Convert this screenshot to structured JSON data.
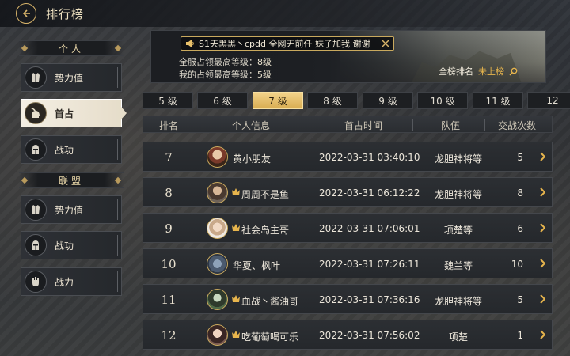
{
  "header": {
    "title": "排行榜"
  },
  "sidebar": {
    "personal_header": "个人",
    "personal_items": [
      {
        "label": "势力值",
        "icon": "armor-icon",
        "active": false
      },
      {
        "label": "首占",
        "icon": "helmet-plume-icon",
        "active": true
      },
      {
        "label": "战功",
        "icon": "knight-helmet-icon",
        "active": false
      }
    ],
    "alliance_header": "联盟",
    "alliance_items": [
      {
        "label": "势力值",
        "icon": "armor-icon",
        "active": false
      },
      {
        "label": "战功",
        "icon": "knight-helmet-icon",
        "active": false
      },
      {
        "label": "战力",
        "icon": "fist-icon",
        "active": false
      }
    ]
  },
  "banner": {
    "announcement": "S1天黑黑丶cpdd 全网无前任 妹子加我 谢谢",
    "server_max_label": "全服占领最高等级：",
    "server_max_value": "8级",
    "my_max_label": "我的占领最高等级：",
    "my_max_value": "5级",
    "my_rank_label": "全榜排名",
    "my_rank_value": "未上榜"
  },
  "level_tabs": [
    "5 级",
    "6 级",
    "7 级",
    "8 级",
    "9 级",
    "10 级",
    "11 级",
    "12"
  ],
  "active_tab": "7 级",
  "table": {
    "columns": [
      "排名",
      "个人信息",
      "首占时间",
      "队伍",
      "交战次数"
    ],
    "rows": [
      {
        "rank": "7",
        "name": "黄小朋友",
        "crown": false,
        "time": "2022-03-31 03:40:10",
        "team": "龙胆神将等",
        "count": "5"
      },
      {
        "rank": "8",
        "name": "周周不是鱼",
        "crown": true,
        "time": "2022-03-31 06:12:22",
        "team": "龙胆神将等",
        "count": "8"
      },
      {
        "rank": "9",
        "name": "社会岛主哥",
        "crown": true,
        "time": "2022-03-31 07:06:01",
        "team": "项楚等",
        "count": "6"
      },
      {
        "rank": "10",
        "name": "华夏、枫叶",
        "crown": false,
        "time": "2022-03-31 07:26:11",
        "team": "魏兰等",
        "count": "10"
      },
      {
        "rank": "11",
        "name": "血战丶酱油哥",
        "crown": true,
        "time": "2022-03-31 07:36:16",
        "team": "龙胆神将等",
        "count": "5"
      },
      {
        "rank": "12",
        "name": "吃葡萄喝可乐",
        "crown": true,
        "time": "2022-03-31 07:56:02",
        "team": "项楚",
        "count": "1"
      }
    ]
  },
  "colors": {
    "gold": "#d9ad52",
    "accent_text": "#e7b54d",
    "panel": "#25282c"
  }
}
